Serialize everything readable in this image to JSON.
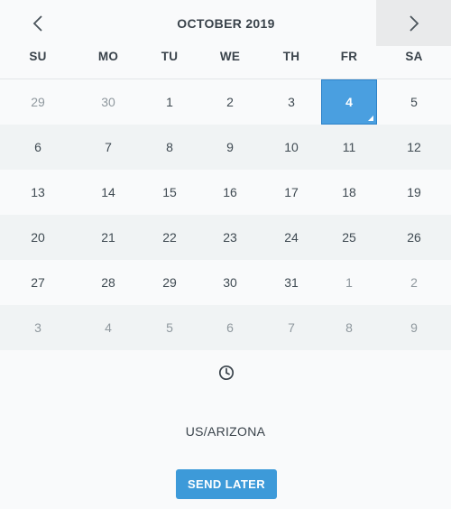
{
  "header": {
    "month_title": "OCTOBER 2019",
    "prev_icon": "chevron-left-icon",
    "next_icon": "chevron-right-icon"
  },
  "weekdays": [
    "SU",
    "MO",
    "TU",
    "WE",
    "TH",
    "FR",
    "SA"
  ],
  "weeks": [
    [
      {
        "label": "29",
        "muted": true
      },
      {
        "label": "30",
        "muted": true
      },
      {
        "label": "1",
        "muted": false
      },
      {
        "label": "2",
        "muted": false
      },
      {
        "label": "3",
        "muted": false
      },
      {
        "label": "4",
        "muted": false,
        "selected": true
      },
      {
        "label": "5",
        "muted": false
      }
    ],
    [
      {
        "label": "6"
      },
      {
        "label": "7"
      },
      {
        "label": "8"
      },
      {
        "label": "9"
      },
      {
        "label": "10"
      },
      {
        "label": "11"
      },
      {
        "label": "12"
      }
    ],
    [
      {
        "label": "13"
      },
      {
        "label": "14"
      },
      {
        "label": "15"
      },
      {
        "label": "16"
      },
      {
        "label": "17"
      },
      {
        "label": "18"
      },
      {
        "label": "19"
      }
    ],
    [
      {
        "label": "20"
      },
      {
        "label": "21"
      },
      {
        "label": "22"
      },
      {
        "label": "23"
      },
      {
        "label": "24"
      },
      {
        "label": "25"
      },
      {
        "label": "26"
      }
    ],
    [
      {
        "label": "27"
      },
      {
        "label": "28"
      },
      {
        "label": "29"
      },
      {
        "label": "30"
      },
      {
        "label": "31"
      },
      {
        "label": "1",
        "muted": true
      },
      {
        "label": "2",
        "muted": true
      }
    ],
    [
      {
        "label": "3",
        "muted": true
      },
      {
        "label": "4",
        "muted": true
      },
      {
        "label": "5",
        "muted": true
      },
      {
        "label": "6",
        "muted": true
      },
      {
        "label": "7",
        "muted": true
      },
      {
        "label": "8",
        "muted": true
      },
      {
        "label": "9",
        "muted": true
      }
    ]
  ],
  "time_icon": "clock-icon",
  "timezone": "US/ARIZONA",
  "send_button": "SEND LATER",
  "colors": {
    "accent": "#3d9ad9",
    "selected_bg": "#4a9fe0",
    "alt_row_bg": "#f0f3f4",
    "muted_text": "#8f989e"
  }
}
